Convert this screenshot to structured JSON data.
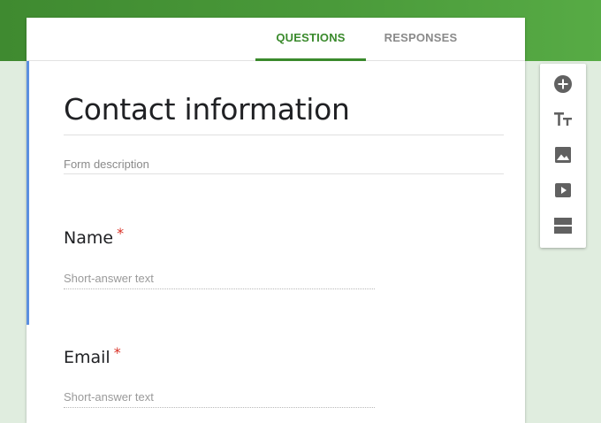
{
  "tabs": [
    {
      "label": "QUESTIONS",
      "active": true
    },
    {
      "label": "RESPONSES",
      "active": false
    }
  ],
  "form": {
    "title": "Contact information",
    "description_placeholder": "Form description"
  },
  "questions": [
    {
      "label": "Name",
      "required_mark": "*",
      "answer_placeholder": "Short-answer text"
    },
    {
      "label": "Email",
      "required_mark": "*",
      "answer_placeholder": "Short-answer text"
    }
  ],
  "toolbox": {
    "icons": [
      "add-question-icon",
      "add-title-icon",
      "add-image-icon",
      "add-video-icon",
      "add-section-icon"
    ]
  },
  "colors": {
    "header_green": "#4a9a3a",
    "active_tab": "#3a8a2c",
    "accent_blue": "#5b8fe0",
    "required_red": "#d93025",
    "page_background": "#e0eddf"
  }
}
